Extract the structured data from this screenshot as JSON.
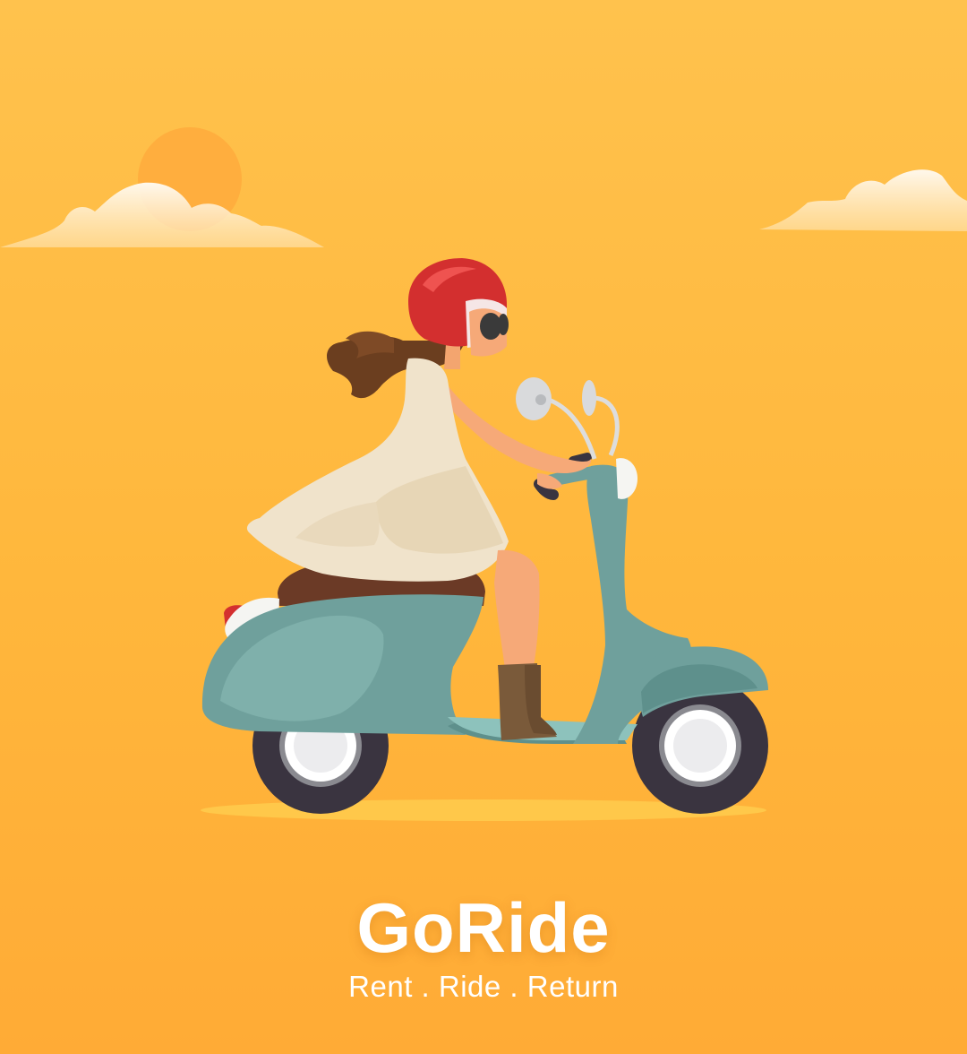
{
  "app": {
    "title": "GoRide",
    "tagline": "Rent . Ride . Return"
  },
  "colors": {
    "background_top": "#FFC24D",
    "background_bottom": "#FFAB36",
    "sun": "#FFAE3E",
    "cloud": "#FFF5E1",
    "scooter_body": "#6FA09C",
    "helmet": "#D32F2F",
    "dress": "#F0E3CB",
    "hair": "#6B3E1F",
    "text": "#FFFFFF"
  },
  "illustration": {
    "icons": [
      "sun-icon",
      "cloud-icon",
      "scooter-icon",
      "rider-icon"
    ]
  }
}
